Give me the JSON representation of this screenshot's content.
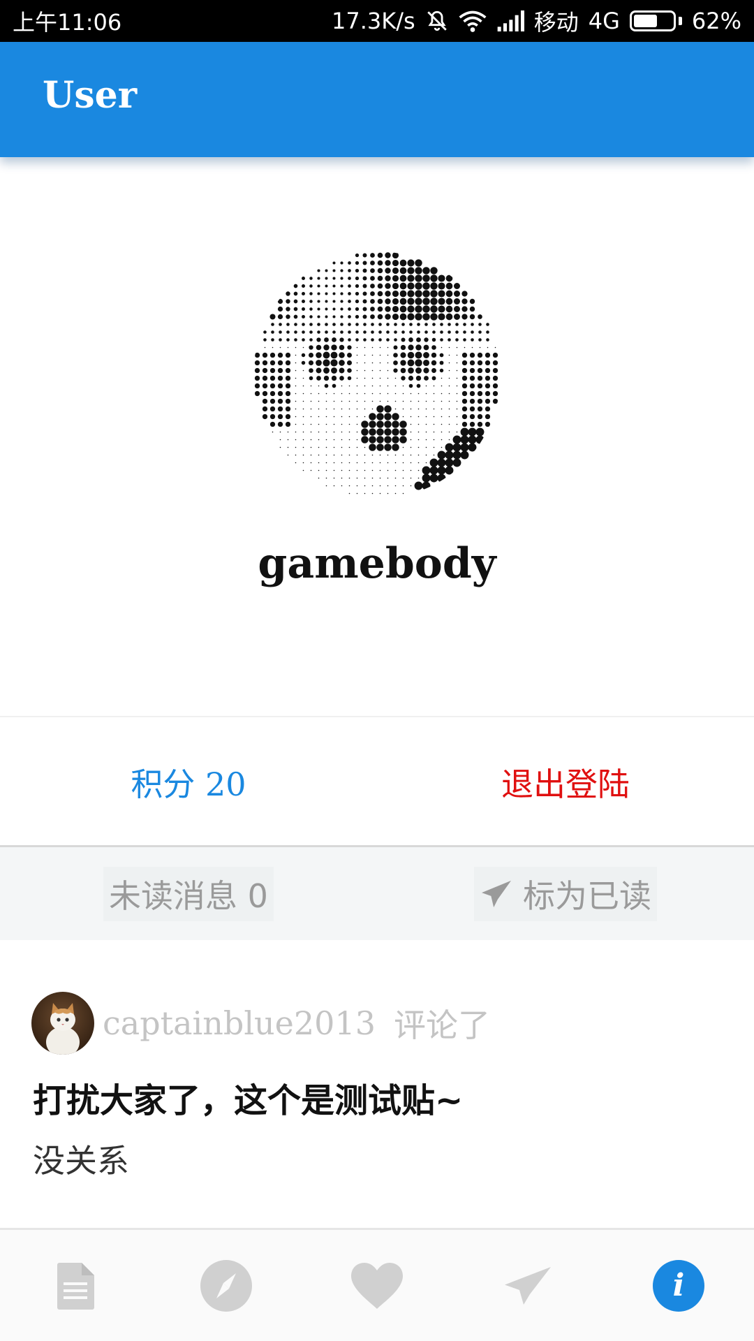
{
  "status_bar": {
    "time": "上午11:06",
    "network_speed": "17.3K/s",
    "carrier": "移动",
    "network_type": "4G",
    "battery": "62%",
    "battery_level": 0.62,
    "icons": [
      "mute-icon",
      "wifi-icon",
      "signal-icon",
      "battery-icon"
    ]
  },
  "app_bar": {
    "title": "User"
  },
  "profile": {
    "username": "gamebody"
  },
  "stats": {
    "points_label": "积分 20",
    "logout_label": "退出登陆"
  },
  "messages": {
    "unread_label": "未读消息 0",
    "mark_read_label": "标为已读"
  },
  "comment": {
    "user": "captainblue2013",
    "action": "评论了",
    "title": "打扰大家了，这个是测试贴~",
    "body": "没关系"
  },
  "bottom_nav": {
    "items": [
      "document-icon",
      "compass-icon",
      "heart-icon",
      "send-icon",
      "info-icon"
    ],
    "active": "info-icon"
  },
  "colors": {
    "primary": "#1a88e0",
    "danger": "#e01010",
    "muted": "#9a9a9a",
    "nav_inactive": "#d0d0d0"
  }
}
